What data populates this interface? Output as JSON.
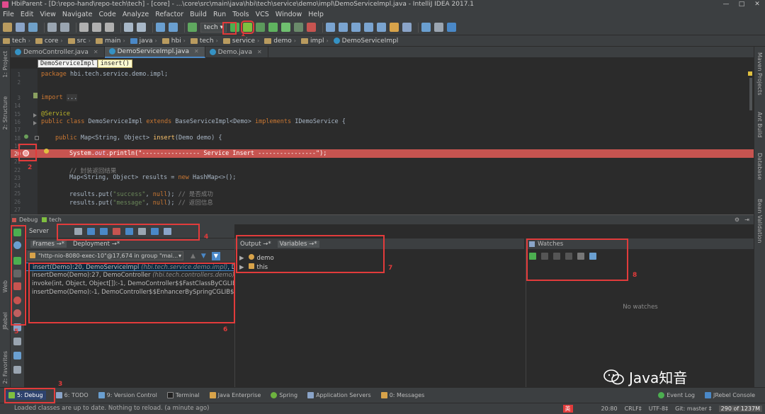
{
  "window": {
    "title": "HbiParent - [D:\\repo-hand\\repo-tech\\tech] - [core] - ...\\core\\src\\main\\java\\hbi\\tech\\service\\demo\\impl\\DemoServiceImpl.java - IntelliJ IDEA 2017.1",
    "controls": [
      "—",
      "□",
      "✕"
    ]
  },
  "menu": [
    "File",
    "Edit",
    "View",
    "Navigate",
    "Code",
    "Analyze",
    "Refactor",
    "Build",
    "Run",
    "Tools",
    "VCS",
    "Window",
    "Help"
  ],
  "toolbar": {
    "run_config": "tech ▾"
  },
  "navbar": [
    "tech",
    "core",
    "src",
    "main",
    "java",
    "hbi",
    "tech",
    "service",
    "demo",
    "impl",
    "DemoServiceImpl"
  ],
  "left_stripe": [
    "1: Project",
    "2: Structure",
    "Web",
    "JRebel",
    "2: Favorites"
  ],
  "right_stripe": [
    "Maven Projects",
    "Ant Build",
    "Database",
    "Bean Validation"
  ],
  "tabs": [
    {
      "label": "DemoController.java",
      "active": false
    },
    {
      "label": "DemoServiceImpl.java",
      "active": true
    },
    {
      "label": "Demo.java",
      "active": false
    }
  ],
  "editor_breadcrumb": {
    "cls": "DemoServiceImpl",
    "method": "insert()"
  },
  "code_text": {
    "l1a": "package ",
    "l1b": "hbi.tech.service.demo.impl;",
    "l3a": "import ",
    "l3b": "...",
    "l15": "@Service",
    "l16a": "public class ",
    "l16b": "DemoServiceImpl ",
    "l16c": "extends ",
    "l16d": "BaseServiceImpl<Demo> ",
    "l16e": "implements ",
    "l16f": "IDemoService {",
    "l18a": "public ",
    "l18b": "Map<String, Object> ",
    "l18c": "insert",
    "l18d": "(Demo demo) {",
    "l20a": "System.",
    "l20b": "out",
    "l20c": ".println(",
    "l20d": "\"---------------- Service Insert ----------------\"",
    "l20e": ");",
    "l22": "// 封装返回结果",
    "l23a": "Map<String, Object> results = ",
    "l23b": "new ",
    "l23c": "HashMap<>();",
    "l25a": "results.put(",
    "l25b": "\"success\"",
    "l25c": ", ",
    "l25d": "null",
    "l25e": "); ",
    "l25f": "// 是否成功",
    "l26a": "results.put(",
    "l26b": "\"message\"",
    "l26c": ", ",
    "l26d": "null",
    "l26e": "); ",
    "l26f": "// 返回信息"
  },
  "line_numbers": {
    "n1": "1",
    "n2": "2",
    "n3": "3",
    "n14": "14",
    "n15": "15",
    "n16": "16",
    "n17": "17",
    "n18": "18",
    "n19": "19",
    "n20": "20",
    "n21": "21",
    "n22": "22",
    "n23": "23",
    "n24": "24",
    "n25": "25",
    "n26": "26",
    "n27": "27"
  },
  "debug": {
    "header": "Debug",
    "config": "tech",
    "server_tab": "Server",
    "frames_tab": "Frames →*",
    "deployment_tab": "Deployment →*",
    "thread": "\"http-nio-8080-exec-10\"@17,674 in group \"mai...",
    "frames": [
      {
        "method": "insert(Demo):20, DemoServiceImpl ",
        "pkg": "(hbi.tech.service.demo.impl)",
        "tail": ", Demo"
      },
      {
        "method": "insertDemo(Demo):27, DemoController ",
        "pkg": "(hbi.tech.controllers.demo)",
        "tail": ", D"
      },
      {
        "method": "invoke(int, Object, Object[]):-1, DemoController$$FastClassByCGLIB$$",
        "pkg": "",
        "tail": ""
      },
      {
        "method": "insertDemo(Demo):-1, DemoController$$EnhancerBySpringCGLIB$$c1",
        "pkg": "",
        "tail": ""
      }
    ],
    "output_tab": "Output →*",
    "variables_tab": "Variables →*",
    "variables": [
      "demo",
      "this"
    ],
    "watches_tab": "Watches",
    "no_watches": "No watches"
  },
  "toolwindows": [
    "5: Debug",
    "6: TODO",
    "9: Version Control",
    "Terminal",
    "Java Enterprise",
    "Spring",
    "Application Servers",
    "0: Messages",
    "Event Log",
    "JRebel Console"
  ],
  "status": {
    "message": "Loaded classes are up to date. Nothing to reload. (a minute ago)",
    "ime": "英",
    "position": "20:80",
    "line_sep": "CRLF‡",
    "encoding": "UTF-8‡",
    "git": "Git: master ‡",
    "memory": "290 of 1237M"
  },
  "annotations": [
    "1",
    "2",
    "3",
    "4",
    "5",
    "6",
    "7",
    "8"
  ],
  "watermark": "Java知音",
  "colors": {
    "breakpoint_line": "#c75450",
    "annotation_red": "#e23b3b",
    "selection_blue": "#0d293e"
  }
}
